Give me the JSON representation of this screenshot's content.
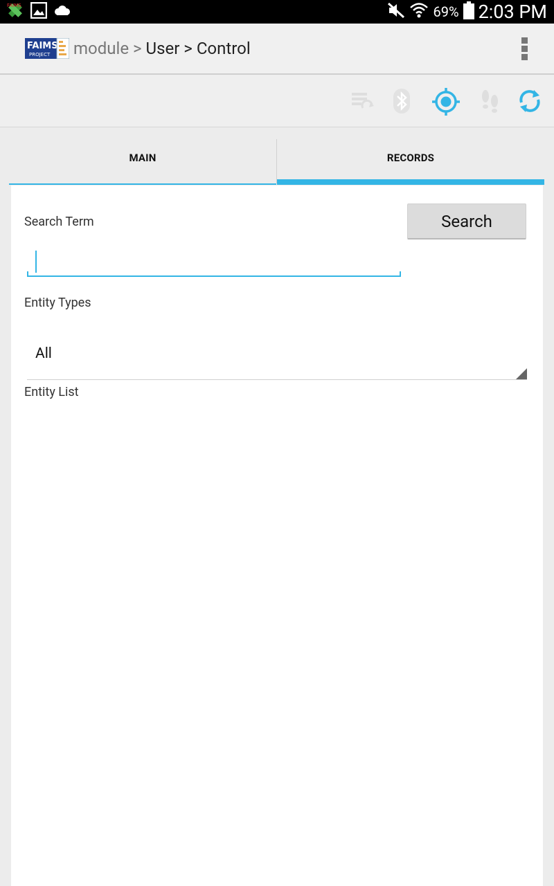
{
  "status_bar": {
    "battery_percent": "69%",
    "time": "2:03 PM",
    "left_icons": [
      "satellite-icon",
      "image-icon",
      "cloud-icon"
    ],
    "right_icons": [
      "mute-icon",
      "wifi-icon",
      "battery-icon"
    ]
  },
  "action_bar": {
    "logo_text": "FAIMS",
    "logo_subtext": "PROJECT",
    "breadcrumb": {
      "module": "module",
      "sep1": " > ",
      "user": "User",
      "sep2": " > ",
      "control": "Control"
    },
    "overflow_icon": "overflow-menu-icon"
  },
  "toolbar": {
    "icons": [
      "sync-list-icon",
      "bluetooth-icon",
      "gps-icon",
      "tracking-icon",
      "refresh-icon"
    ],
    "accent": "#33b5e5"
  },
  "tabs": [
    {
      "label": "MAIN",
      "selected": false
    },
    {
      "label": "RECORDS",
      "selected": true
    }
  ],
  "form": {
    "search_term_label": "Search Term",
    "search_button_label": "Search",
    "search_input_value": "",
    "entity_types_label": "Entity Types",
    "entity_types_selected": "All",
    "entity_list_label": "Entity List"
  }
}
